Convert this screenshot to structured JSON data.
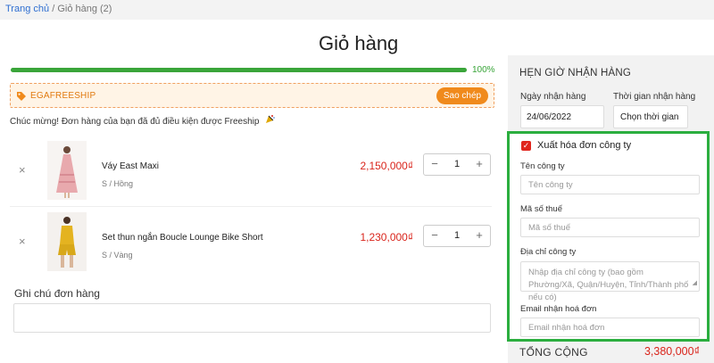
{
  "breadcrumb": {
    "home": "Trang chủ",
    "separator": "/",
    "current": "Giỏ hàng (2)"
  },
  "page": {
    "title": "Giỏ hàng"
  },
  "progress": {
    "percent_label": "100%",
    "value": 1.0,
    "color": "#3aa53a"
  },
  "coupon": {
    "icon": "tag-icon",
    "code": "EGAFREESHIP",
    "copy_label": "Sao chép"
  },
  "congrats": {
    "text": "Chúc mừng! Đơn hàng của bạn đã đủ điều kiện được Freeship",
    "icon": "party-icon"
  },
  "cart": {
    "items": [
      {
        "name": "Váy East Maxi",
        "variant": "S / Hồng",
        "price": "2,150,000₫",
        "quantity": "1"
      },
      {
        "name": "Set thun ngắn Boucle Lounge Bike Short",
        "variant": "S / Vàng",
        "price": "1,230,000₫",
        "quantity": "1"
      }
    ],
    "remove_symbol": "×",
    "minus_symbol": "−",
    "plus_symbol": "+"
  },
  "note": {
    "label": "Ghi chú đơn hàng",
    "value": ""
  },
  "delivery": {
    "title": "HẸN GIỜ NHẬN HÀNG",
    "date_label": "Ngày nhận hàng",
    "date_value": "24/06/2022",
    "time_label": "Thời gian nhận hàng",
    "time_value": "Chọn thời gian"
  },
  "invoice": {
    "checkbox_label": "Xuất hóa đơn công ty",
    "checked": true,
    "company_label": "Tên công ty",
    "company_placeholder": "Tên công ty",
    "tax_label": "Mã số thuế",
    "tax_placeholder": "Mã số thuế",
    "address_label": "Địa chỉ công ty",
    "address_placeholder": "Nhập địa chỉ công ty (bao gồm Phường/Xã, Quận/Huyện, Tỉnh/Thành phố nếu có)",
    "email_label": "Email nhận hoá đơn",
    "email_placeholder": "Email nhận hoá đơn"
  },
  "summary": {
    "total_label": "TỔNG CỘNG",
    "total_value": "3,380,000₫"
  },
  "colors": {
    "accent": "#f08a1c",
    "price": "#d9241b",
    "highlight_border": "#2bae3f",
    "link": "#2f6fd1"
  }
}
